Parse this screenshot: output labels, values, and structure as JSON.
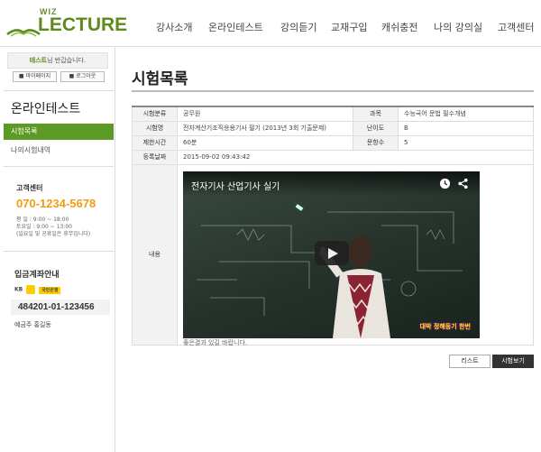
{
  "header": {
    "logo_top": "WIZ",
    "logo_main": "LECTURE",
    "nav": [
      "강사소개",
      "온라인테스트",
      "강의듣기",
      "교재구입",
      "캐쉬충전",
      "나의 강의실",
      "고객센터"
    ]
  },
  "sidebar": {
    "user_name": "테스트",
    "welcome_suffix": "님 반갑습니다.",
    "mypage_label": "마이페이지",
    "logout_label": "로그아웃",
    "section_title": "온라인테스트",
    "menu": [
      "시험목록",
      "나의시험내역"
    ],
    "support": {
      "title": "고객센터",
      "phone": "070-1234-5678",
      "hours_weekday": "평 일 : 9:00 ~ 18:00",
      "hours_saturday": "토요일 : 9:00 ~ 13:00",
      "note": "(일요일 및 공휴일은 휴무입니다)"
    },
    "bank": {
      "title": "입금계좌안내",
      "bank_prefix": "KB",
      "bank_name": "국민은행",
      "account": "484201-01-123456",
      "holder": "예금주 홍길동"
    }
  },
  "main": {
    "page_title": "시험목록",
    "table": {
      "category_label": "시험분류",
      "category_value": "공무원",
      "subject_label": "과목",
      "subject_value": "수능국어 문법 필수개념",
      "name_label": "시험명",
      "name_value": "전자계산기조직응용기사 필기 (2013년 3회 기출문제)",
      "difficulty_label": "난이도",
      "difficulty_value": "B",
      "time_label": "제한시간",
      "time_value": "60분",
      "count_label": "문항수",
      "count_value": "5",
      "date_label": "등록날짜",
      "date_value": "2015-09-02 09:43:42",
      "content_label": "내용"
    },
    "video": {
      "title": "전자기사 산업기사 실기",
      "caption_overlay": "대박 정해등기 한번"
    },
    "content_text": "좋은결과 있길 바랍니다.",
    "buttons": {
      "list": "리스트",
      "start": "시험보기"
    }
  }
}
